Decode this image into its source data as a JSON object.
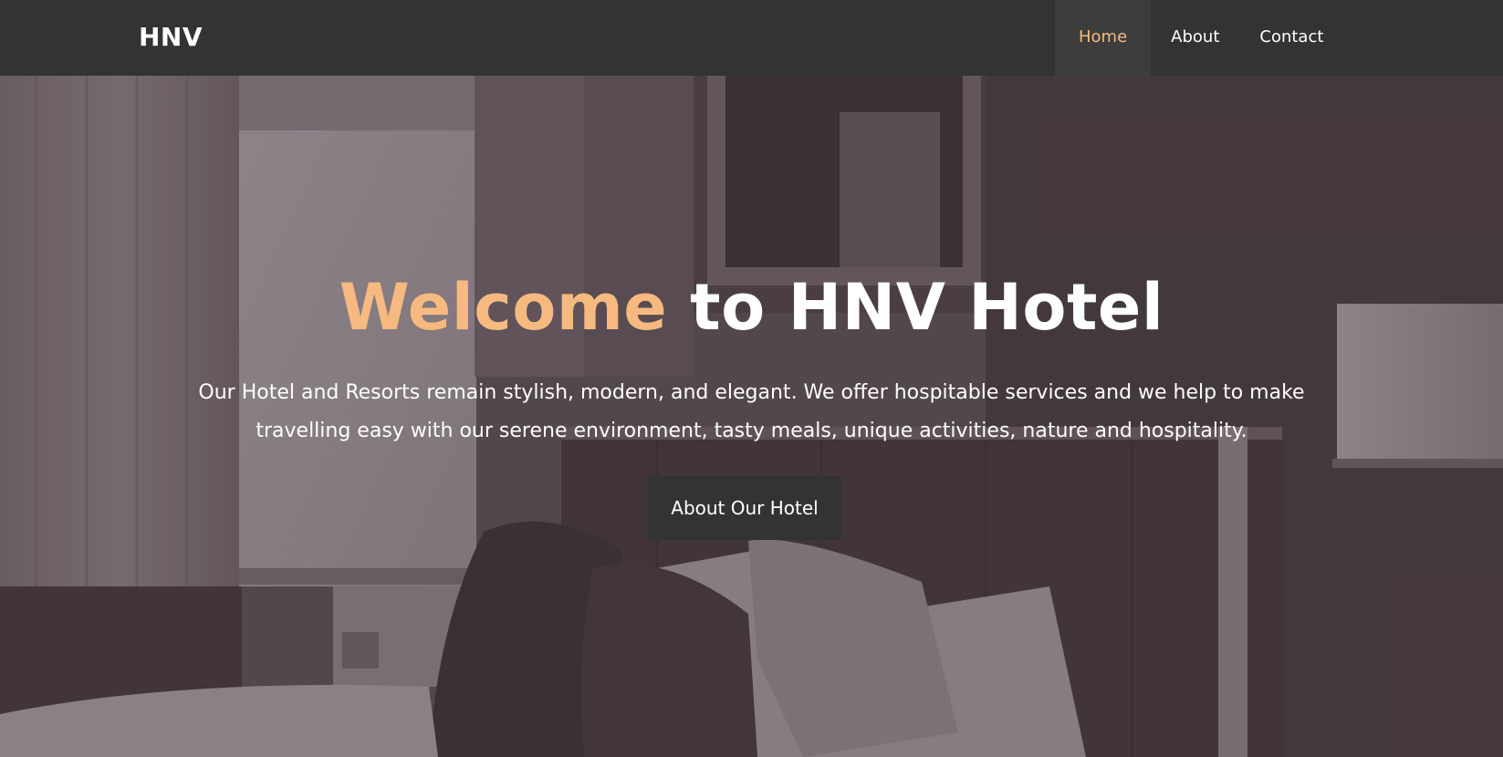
{
  "navbar": {
    "brand": "HNV",
    "links": [
      {
        "label": "Home",
        "active": true
      },
      {
        "label": "About",
        "active": false
      },
      {
        "label": "Contact",
        "active": false
      }
    ]
  },
  "hero": {
    "title_accent": "Welcome",
    "title_rest": " to HNV Hotel",
    "description": "Our Hotel and Resorts remain stylish, modern, and elegant. We offer hospitable services and we help to make travelling easy with our serene environment, tasty meals, unique activities, nature and hospitality.",
    "button_label": "About Our Hotel"
  },
  "colors": {
    "navbar_bg": "#333333",
    "accent": "#f6b97f",
    "button_bg": "#333333",
    "text": "#ffffff"
  }
}
